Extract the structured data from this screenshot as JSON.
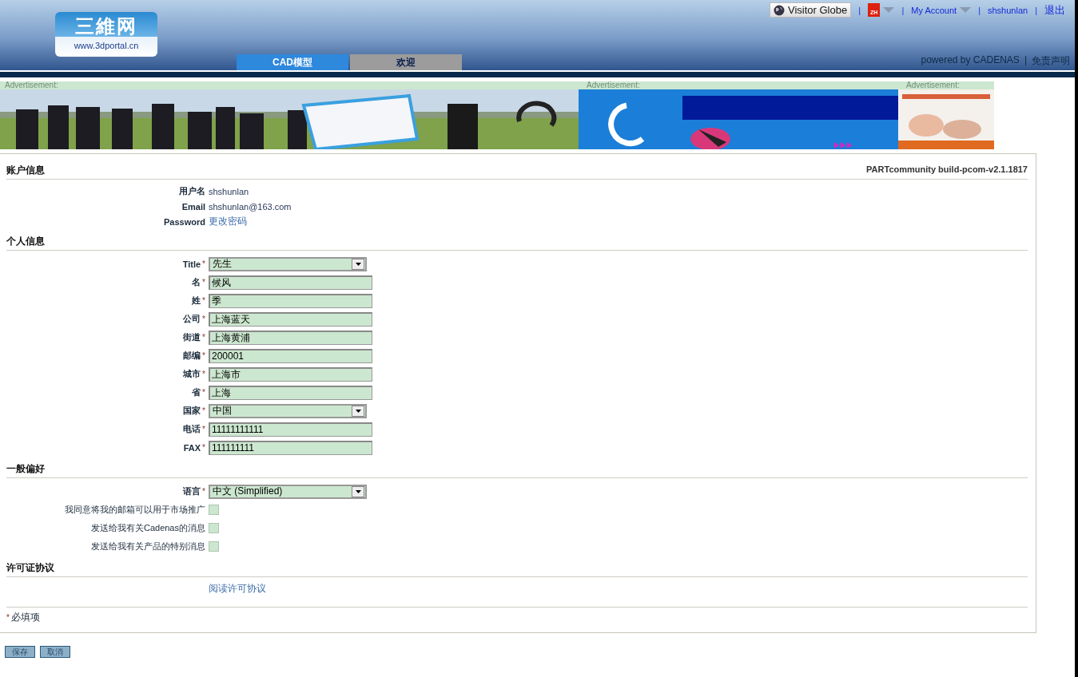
{
  "header": {
    "logo": {
      "title": "三維网",
      "url": "www.3dportal.cn"
    },
    "top_links": [
      {
        "kind": "globe",
        "label": "Visitor Globe"
      },
      {
        "kind": "flag",
        "label": "ZH",
        "sep": "|"
      },
      {
        "kind": "menu",
        "label": "My Account",
        "sep": "|"
      },
      {
        "kind": "link",
        "label": "shshunlan",
        "sep": "|"
      },
      {
        "kind": "link",
        "label": "退出",
        "sep": "|"
      }
    ],
    "tabs": [
      {
        "label": "CAD模型",
        "selected": true
      },
      {
        "label": "欢迎",
        "selected": false
      }
    ],
    "powered_by": "powered by CADENAS",
    "disclaimer_sep": "|",
    "disclaimer": "免责声明"
  },
  "ads": [
    {
      "label": "Advertisement:",
      "kind": "people"
    },
    {
      "label": "Advertisement:",
      "kind": "ocean"
    },
    {
      "label": "Advertisement:",
      "kind": "forum"
    }
  ],
  "build": "PARTcommunity build-pcom-v2.1.1817",
  "sections": [
    {
      "title": "账户信息",
      "rows": [
        {
          "kind": "text",
          "label": "用户名",
          "value": "shshunlan"
        },
        {
          "kind": "text",
          "label": "Email",
          "value": "shshunlan@163.com"
        },
        {
          "kind": "link",
          "label": "Password",
          "value": "更改密码"
        }
      ]
    },
    {
      "title": "个人信息",
      "rows": [
        {
          "kind": "select",
          "label": "Title",
          "required": true,
          "value": "先生"
        },
        {
          "kind": "input",
          "label": "名",
          "required": true,
          "value": "候风"
        },
        {
          "kind": "input",
          "label": "姓",
          "required": true,
          "value": "季"
        },
        {
          "kind": "input",
          "label": "公司",
          "required": true,
          "value": "上海蓝天"
        },
        {
          "kind": "input",
          "label": "街道",
          "required": true,
          "value": "上海黄浦"
        },
        {
          "kind": "input",
          "label": "邮编",
          "required": true,
          "value": "200001"
        },
        {
          "kind": "input",
          "label": "城市",
          "required": true,
          "value": "上海市"
        },
        {
          "kind": "input",
          "label": "省",
          "required": true,
          "value": "上海"
        },
        {
          "kind": "select",
          "label": "国家",
          "required": true,
          "value": "中国"
        },
        {
          "kind": "input",
          "label": "电话",
          "required": true,
          "value": "11111111111"
        },
        {
          "kind": "input",
          "label": "FAX",
          "required": true,
          "value": "111111111"
        }
      ]
    },
    {
      "title": "一般偏好",
      "rows": [
        {
          "kind": "select",
          "label": "语言",
          "required": true,
          "value": "中文 (Simplified)"
        },
        {
          "kind": "checkbox",
          "label": "我同意将我的邮箱可以用于市场推广",
          "checked": false
        },
        {
          "kind": "checkbox",
          "label": "发送给我有关Cadenas的消息",
          "checked": false
        },
        {
          "kind": "checkbox",
          "label": "发送给我有关产品的特别消息",
          "checked": false
        }
      ]
    },
    {
      "title": "许可证协议",
      "rows": [
        {
          "kind": "link",
          "value": "阅读许可协议"
        }
      ]
    }
  ],
  "required_note": {
    "mark": "*",
    "text": "必填项"
  },
  "buttons": [
    "保存",
    "取消"
  ]
}
